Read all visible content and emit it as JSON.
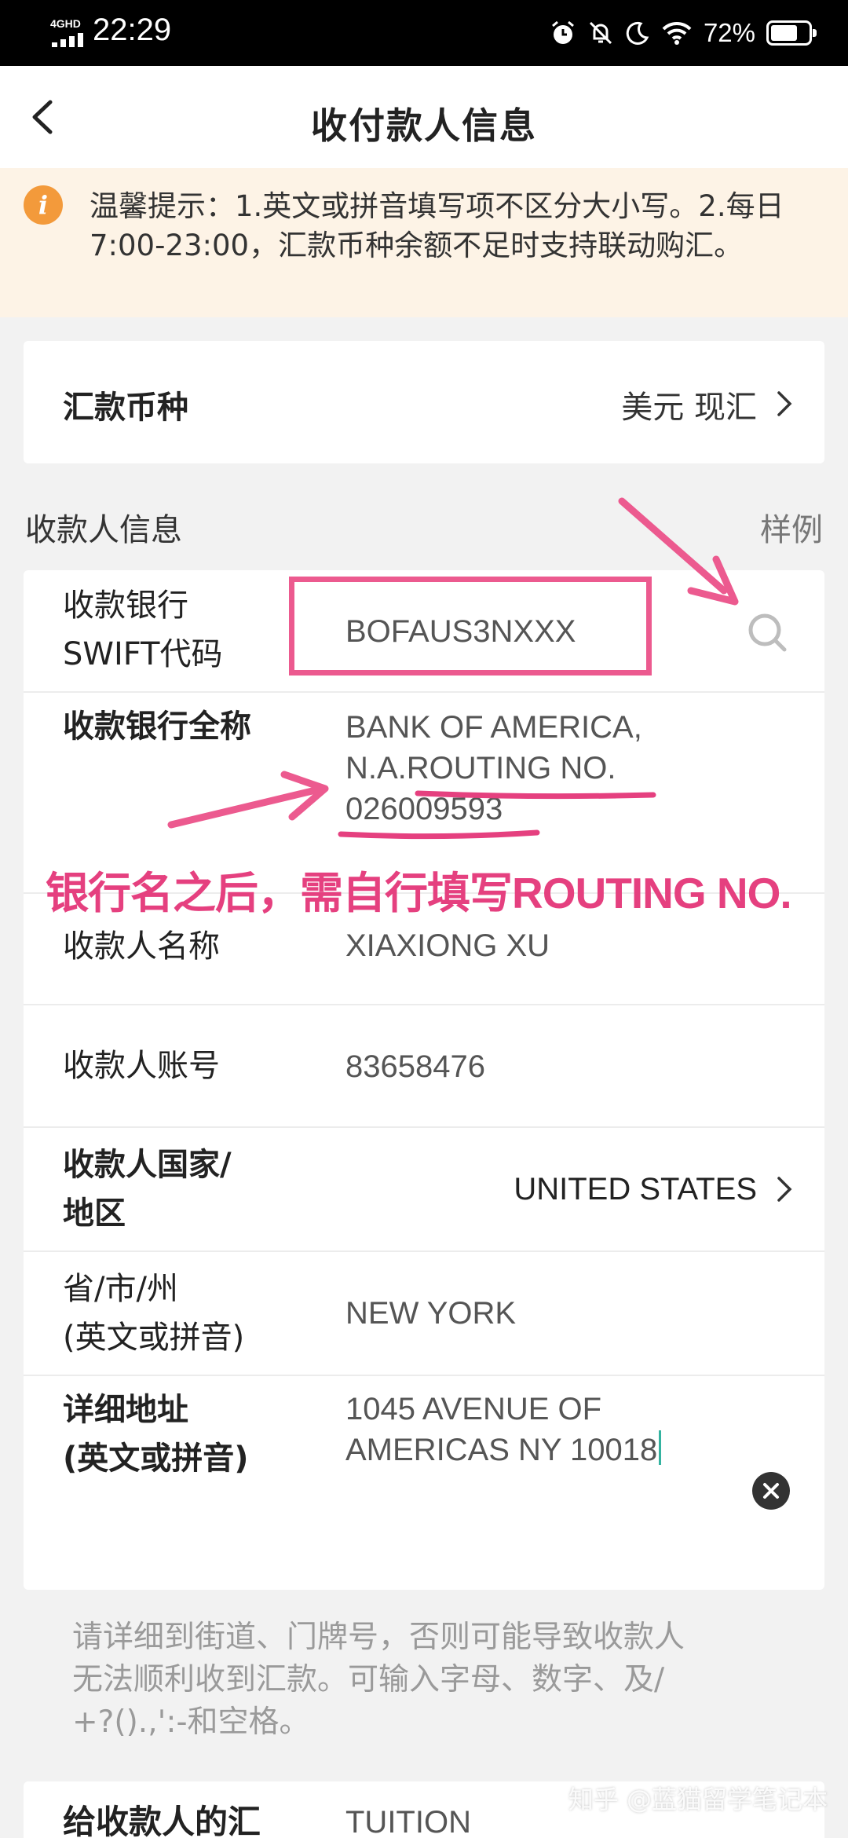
{
  "status_bar": {
    "network": "4GHD",
    "time": "22:29",
    "battery": "72%",
    "battery_level": 0.72,
    "icons": [
      "alarm-icon",
      "mute-icon",
      "moon-icon",
      "wifi-icon",
      "battery-icon"
    ]
  },
  "header": {
    "title": "收付款人信息",
    "back_icon": "chevron-left-icon"
  },
  "notice": {
    "icon": "info-icon",
    "icon_glyph": "i",
    "text": "温馨提示：1.英文或拼音填写项不区分大小写。2.每日7:00-23:00，汇款币种余额不足时支持联动购汇。"
  },
  "currency": {
    "label": "汇款币种",
    "value": "美元 现汇"
  },
  "payee_section": {
    "title": "收款人信息",
    "sample_link": "样例"
  },
  "fields": {
    "swift": {
      "label_line1": "收款银行",
      "label_line2": "SWIFT代码",
      "value": "BOFAUS3NXXX"
    },
    "bank_name": {
      "label": "收款银行全称",
      "line1": "BANK OF AMERICA,",
      "line2": "N.A.ROUTING NO.",
      "line3": "026009593"
    },
    "payee_name": {
      "label": "收款人名称",
      "value": "XIAXIONG XU"
    },
    "account": {
      "label": "收款人账号",
      "value": "83658476"
    },
    "country": {
      "label_line1": "收款人国家/",
      "label_line2": "地区",
      "value": "UNITED STATES"
    },
    "state": {
      "label_line1": "省/市/州",
      "label_line2": "(英文或拼音)",
      "value": "NEW YORK"
    },
    "address": {
      "label_line1": "详细地址",
      "label_line2": "(英文或拼音)",
      "line1": "1045 AVENUE OF",
      "line2": "AMERICAS NY 10018"
    }
  },
  "annotation": {
    "text": "银行名之后，需自行填写ROUTING NO.",
    "color": "#e5407f"
  },
  "hint": {
    "line1": "请详细到街道、门牌号，否则可能导致收款人",
    "line2": "无法顺利收到汇款。可输入字母、数字、及/",
    "line3": "+?().,':-和空格。"
  },
  "bottom": {
    "label": "给收款人的汇",
    "value": "TUITION"
  },
  "watermark": "知乎 @蓝猫留学笔记本",
  "colors": {
    "accent_orange": "#f39a3b",
    "notice_bg": "#fdf3e6",
    "highlight_pink": "#ec5a8f",
    "caret": "#34b3a0"
  }
}
